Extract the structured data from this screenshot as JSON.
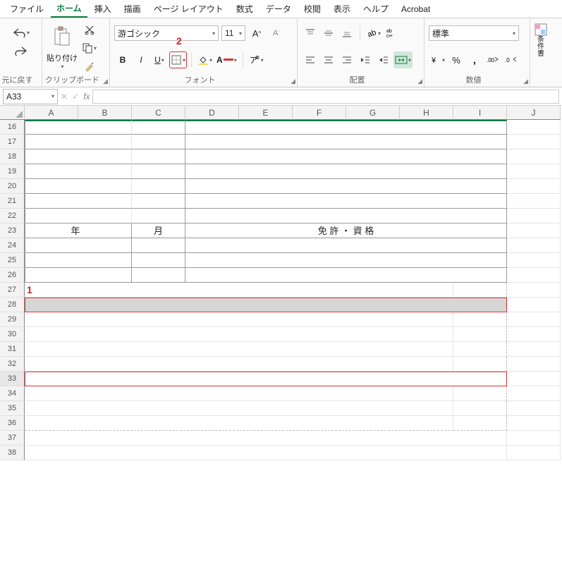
{
  "menu": {
    "file": "ファイル",
    "home": "ホーム",
    "insert": "挿入",
    "draw": "描画",
    "layout": "ページ レイアウト",
    "formulas": "数式",
    "data": "データ",
    "review": "校閲",
    "view": "表示",
    "help": "ヘルプ",
    "acrobat": "Acrobat"
  },
  "ribbon": {
    "undo": "元に戻す",
    "clipboard": "クリップボード",
    "paste": "貼り付け",
    "fontgroup": "フォント",
    "align": "配置",
    "number": "数値",
    "fontname": "游ゴシック",
    "fontsize": "11",
    "bold": "B",
    "italic": "I",
    "underline": "U",
    "numberformat": "標準",
    "cond": "条件書"
  },
  "namebox": "A33",
  "fx": "fx",
  "cols": [
    "A",
    "B",
    "C",
    "D",
    "E",
    "F",
    "G",
    "H",
    "I",
    "J"
  ],
  "rows": [
    "16",
    "17",
    "18",
    "19",
    "20",
    "21",
    "22",
    "23",
    "24",
    "25",
    "26",
    "27",
    "28",
    "29",
    "30",
    "31",
    "32",
    "33",
    "34",
    "35",
    "36",
    "37",
    "38"
  ],
  "cells": {
    "r23": {
      "year": "年",
      "month": "月",
      "license": "免 許 ・ 資 格"
    }
  },
  "annot": {
    "one": "1",
    "two": "2"
  }
}
